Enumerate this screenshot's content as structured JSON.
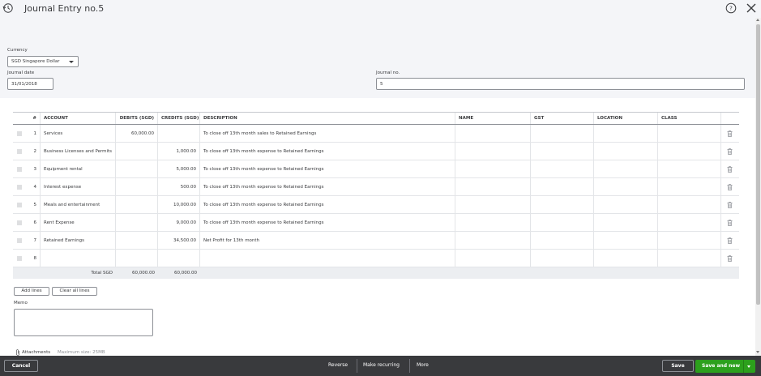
{
  "header": {
    "title": "Journal Entry no.5"
  },
  "form": {
    "currency_label": "Currency",
    "currency_value": "SGD Singapore Dollar",
    "journal_date_label": "Journal date",
    "journal_date_value": "31/01/2018",
    "journal_no_label": "Journal no.",
    "journal_no_value": "5"
  },
  "table": {
    "columns": {
      "idx": "#",
      "account": "ACCOUNT",
      "debits": "DEBITS (SGD)",
      "credits": "CREDITS (SGD)",
      "description": "DESCRIPTION",
      "name": "NAME",
      "gst": "GST",
      "location": "LOCATION",
      "class": "CLASS"
    },
    "rows": [
      {
        "idx": "1",
        "account": "Services",
        "debit": "60,000.00",
        "credit": "",
        "description": "To close off 13th month sales to Retained Earnings"
      },
      {
        "idx": "2",
        "account": "Business Licenses and Permits",
        "debit": "",
        "credit": "1,000.00",
        "description": "To close off 13th month expense to Retained Earnings"
      },
      {
        "idx": "3",
        "account": "Equipment rental",
        "debit": "",
        "credit": "5,000.00",
        "description": "To close off 13th month expense to Retained Earnings"
      },
      {
        "idx": "4",
        "account": "Interest expense",
        "debit": "",
        "credit": "500.00",
        "description": "To close off 13th month expense to Retained Earnings"
      },
      {
        "idx": "5",
        "account": "Meals and entertainment",
        "debit": "",
        "credit": "10,000.00",
        "description": "To close off 13th month expense to Retained Earnings"
      },
      {
        "idx": "6",
        "account": "Rent Expense",
        "debit": "",
        "credit": "9,000.00",
        "description": "To close off 13th month expense to Retained Earnings"
      },
      {
        "idx": "7",
        "account": "Retained Earnings",
        "debit": "",
        "credit": "34,500.00",
        "description": "Net Profit for 13th month"
      },
      {
        "idx": "8",
        "account": "",
        "debit": "",
        "credit": "",
        "description": ""
      }
    ],
    "total_label": "Total SGD",
    "total_debit": "60,000.00",
    "total_credit": "60,000.00"
  },
  "actions": {
    "add_lines": "Add lines",
    "clear_all_lines": "Clear all lines",
    "memo_label": "Memo",
    "attachments_label": "Attachments",
    "attachments_max": "Maximum size: 25MB"
  },
  "footer": {
    "cancel": "Cancel",
    "reverse": "Reverse",
    "make_recurring": "Make recurring",
    "more": "More",
    "save": "Save",
    "save_and_new": "Save and new"
  }
}
